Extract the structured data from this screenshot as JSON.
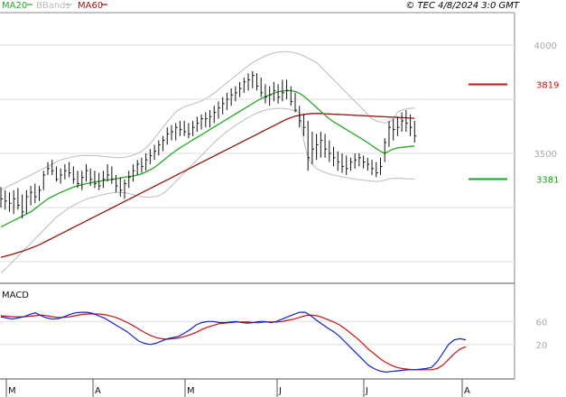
{
  "header": {
    "legend": [
      {
        "label": "MA20",
        "color": "#22aa22"
      },
      {
        "label": "BBands",
        "color": "#bbbbbb"
      },
      {
        "label": "MA60",
        "color": "#991111"
      }
    ],
    "stamp": "© TEC 4/8/2024 3:0 GMT"
  },
  "chart_data": [
    {
      "type": "line",
      "title": "",
      "x_months": [
        "M",
        "A",
        "M",
        "J",
        "J",
        "A"
      ],
      "y_ticks": [
        "4000",
        "3500"
      ],
      "ylim": [
        2900,
        4150
      ],
      "levels": [
        {
          "label": "3819",
          "value": 3819,
          "color": "#cc1111"
        },
        {
          "label": "3381",
          "value": 3381,
          "color": "#11aa11"
        }
      ],
      "n_days": 110,
      "price_ohlc_bars": [
        [
          3345,
          3250,
          3290
        ],
        [
          3330,
          3240,
          3280
        ],
        [
          3320,
          3230,
          3270
        ],
        [
          3330,
          3220,
          3290
        ],
        [
          3340,
          3240,
          3260
        ],
        [
          3310,
          3200,
          3230
        ],
        [
          3330,
          3220,
          3300
        ],
        [
          3350,
          3260,
          3320
        ],
        [
          3360,
          3270,
          3300
        ],
        [
          3350,
          3280,
          3330
        ],
        [
          3420,
          3330,
          3400
        ],
        [
          3460,
          3400,
          3430
        ],
        [
          3470,
          3400,
          3420
        ],
        [
          3440,
          3370,
          3380
        ],
        [
          3430,
          3360,
          3400
        ],
        [
          3450,
          3380,
          3420
        ],
        [
          3460,
          3390,
          3410
        ],
        [
          3440,
          3360,
          3380
        ],
        [
          3420,
          3340,
          3360
        ],
        [
          3420,
          3330,
          3390
        ],
        [
          3450,
          3370,
          3420
        ],
        [
          3430,
          3350,
          3380
        ],
        [
          3420,
          3340,
          3360
        ],
        [
          3410,
          3330,
          3350
        ],
        [
          3420,
          3340,
          3380
        ],
        [
          3450,
          3370,
          3400
        ],
        [
          3440,
          3360,
          3380
        ],
        [
          3400,
          3320,
          3350
        ],
        [
          3390,
          3300,
          3330
        ],
        [
          3380,
          3290,
          3360
        ],
        [
          3420,
          3340,
          3390
        ],
        [
          3450,
          3370,
          3420
        ],
        [
          3470,
          3400,
          3450
        ],
        [
          3480,
          3410,
          3440
        ],
        [
          3500,
          3420,
          3470
        ],
        [
          3520,
          3450,
          3490
        ],
        [
          3540,
          3470,
          3510
        ],
        [
          3560,
          3490,
          3540
        ],
        [
          3580,
          3510,
          3560
        ],
        [
          3620,
          3540,
          3590
        ],
        [
          3630,
          3560,
          3600
        ],
        [
          3640,
          3560,
          3620
        ],
        [
          3650,
          3580,
          3610
        ],
        [
          3650,
          3580,
          3600
        ],
        [
          3640,
          3570,
          3590
        ],
        [
          3650,
          3580,
          3620
        ],
        [
          3670,
          3600,
          3640
        ],
        [
          3680,
          3610,
          3660
        ],
        [
          3690,
          3620,
          3660
        ],
        [
          3700,
          3620,
          3670
        ],
        [
          3720,
          3640,
          3690
        ],
        [
          3740,
          3660,
          3710
        ],
        [
          3760,
          3680,
          3730
        ],
        [
          3780,
          3700,
          3750
        ],
        [
          3800,
          3720,
          3770
        ],
        [
          3810,
          3740,
          3780
        ],
        [
          3830,
          3760,
          3800
        ],
        [
          3850,
          3780,
          3830
        ],
        [
          3870,
          3790,
          3840
        ],
        [
          3880,
          3800,
          3860
        ],
        [
          3870,
          3790,
          3810
        ],
        [
          3850,
          3760,
          3780
        ],
        [
          3820,
          3730,
          3760
        ],
        [
          3810,
          3720,
          3770
        ],
        [
          3830,
          3740,
          3790
        ],
        [
          3820,
          3730,
          3760
        ],
        [
          3840,
          3740,
          3780
        ],
        [
          3840,
          3750,
          3790
        ],
        [
          3810,
          3720,
          3740
        ],
        [
          3780,
          3690,
          3700
        ],
        [
          3720,
          3620,
          3650
        ],
        [
          3680,
          3580,
          3620
        ],
        [
          3650,
          3420,
          3480
        ],
        [
          3600,
          3450,
          3520
        ],
        [
          3590,
          3470,
          3540
        ],
        [
          3600,
          3480,
          3560
        ],
        [
          3590,
          3480,
          3520
        ],
        [
          3560,
          3460,
          3500
        ],
        [
          3530,
          3440,
          3480
        ],
        [
          3510,
          3420,
          3460
        ],
        [
          3500,
          3410,
          3440
        ],
        [
          3490,
          3400,
          3430
        ],
        [
          3480,
          3420,
          3460
        ],
        [
          3500,
          3430,
          3470
        ],
        [
          3500,
          3440,
          3480
        ],
        [
          3490,
          3430,
          3460
        ],
        [
          3480,
          3420,
          3450
        ],
        [
          3470,
          3400,
          3430
        ],
        [
          3460,
          3390,
          3410
        ],
        [
          3480,
          3400,
          3440
        ],
        [
          3570,
          3460,
          3550
        ],
        [
          3650,
          3530,
          3620
        ],
        [
          3660,
          3560,
          3610
        ],
        [
          3670,
          3580,
          3620
        ],
        [
          3690,
          3600,
          3650
        ],
        [
          3700,
          3600,
          3640
        ],
        [
          3680,
          3580,
          3620
        ],
        [
          3650,
          3550,
          3580
        ]
      ],
      "ma20": [
        3160,
        3170,
        3180,
        3190,
        3200,
        3210,
        3220,
        3230,
        3245,
        3260,
        3275,
        3290,
        3300,
        3310,
        3320,
        3328,
        3336,
        3344,
        3350,
        3356,
        3360,
        3364,
        3368,
        3371,
        3374,
        3377,
        3380,
        3383,
        3386,
        3390,
        3393,
        3396,
        3400,
        3406,
        3414,
        3424,
        3436,
        3450,
        3466,
        3482,
        3498,
        3512,
        3526,
        3538,
        3550,
        3562,
        3574,
        3586,
        3598,
        3610,
        3622,
        3634,
        3646,
        3658,
        3670,
        3682,
        3694,
        3706,
        3718,
        3730,
        3742,
        3752,
        3762,
        3770,
        3778,
        3784,
        3788,
        3790,
        3790,
        3786,
        3778,
        3764,
        3748,
        3730,
        3712,
        3694,
        3676,
        3660,
        3646,
        3634,
        3622,
        3610,
        3598,
        3586,
        3574,
        3562,
        3550,
        3536,
        3522,
        3510,
        3500,
        3510,
        3520,
        3525,
        3528,
        3530,
        3532,
        3534
      ],
      "ma60": [
        3020,
        3025,
        3030,
        3036,
        3042,
        3048,
        3055,
        3062,
        3070,
        3078,
        3088,
        3098,
        3108,
        3118,
        3128,
        3138,
        3148,
        3158,
        3168,
        3178,
        3188,
        3198,
        3208,
        3218,
        3228,
        3238,
        3248,
        3258,
        3268,
        3278,
        3288,
        3298,
        3308,
        3318,
        3328,
        3338,
        3348,
        3358,
        3368,
        3378,
        3388,
        3398,
        3408,
        3418,
        3428,
        3438,
        3448,
        3458,
        3468,
        3478,
        3488,
        3498,
        3508,
        3518,
        3528,
        3538,
        3548,
        3558,
        3568,
        3578,
        3588,
        3598,
        3608,
        3618,
        3628,
        3638,
        3648,
        3658,
        3665,
        3672,
        3676,
        3680,
        3682,
        3684,
        3684,
        3684,
        3683,
        3682,
        3681,
        3680,
        3679,
        3678,
        3677,
        3676,
        3675,
        3674,
        3673,
        3672,
        3671,
        3670,
        3669,
        3668,
        3667,
        3666,
        3665,
        3664,
        3663,
        3662
      ],
      "bb_upper": [
        3330,
        3340,
        3350,
        3360,
        3370,
        3380,
        3390,
        3400,
        3410,
        3420,
        3430,
        3440,
        3450,
        3460,
        3470,
        3475,
        3480,
        3485,
        3488,
        3490,
        3490,
        3490,
        3490,
        3488,
        3486,
        3484,
        3482,
        3480,
        3480,
        3482,
        3486,
        3492,
        3500,
        3510,
        3525,
        3545,
        3570,
        3595,
        3620,
        3645,
        3670,
        3690,
        3705,
        3715,
        3722,
        3728,
        3734,
        3742,
        3752,
        3764,
        3778,
        3794,
        3810,
        3826,
        3842,
        3858,
        3874,
        3890,
        3905,
        3918,
        3930,
        3940,
        3950,
        3958,
        3964,
        3968,
        3970,
        3970,
        3968,
        3964,
        3958,
        3950,
        3940,
        3930,
        3920,
        3900,
        3880,
        3860,
        3840,
        3820,
        3800,
        3780,
        3760,
        3740,
        3720,
        3700,
        3680,
        3660,
        3650,
        3645,
        3640,
        3645,
        3660,
        3690,
        3700,
        3705,
        3708,
        3710
      ],
      "bb_lower": [
        2950,
        2965,
        2985,
        3005,
        3025,
        3045,
        3065,
        3085,
        3105,
        3125,
        3145,
        3165,
        3185,
        3205,
        3220,
        3235,
        3248,
        3260,
        3270,
        3280,
        3288,
        3295,
        3300,
        3305,
        3310,
        3314,
        3318,
        3320,
        3320,
        3318,
        3315,
        3310,
        3305,
        3300,
        3298,
        3298,
        3300,
        3305,
        3315,
        3330,
        3350,
        3370,
        3390,
        3410,
        3430,
        3450,
        3470,
        3490,
        3510,
        3530,
        3550,
        3568,
        3585,
        3600,
        3615,
        3630,
        3642,
        3654,
        3666,
        3676,
        3686,
        3694,
        3700,
        3704,
        3706,
        3708,
        3708,
        3706,
        3702,
        3696,
        3690,
        3560,
        3480,
        3450,
        3430,
        3420,
        3412,
        3405,
        3400,
        3396,
        3392,
        3388,
        3384,
        3380,
        3378,
        3376,
        3374,
        3372,
        3370,
        3372,
        3376,
        3382,
        3384,
        3385,
        3384,
        3383,
        3382,
        3381
      ],
      "macd_ticks": [
        "60",
        "20"
      ],
      "macd_ylim": [
        -40,
        120
      ],
      "macd_line": [
        68,
        66,
        64,
        66,
        68,
        72,
        75,
        70,
        66,
        64,
        65,
        68,
        72,
        75,
        76,
        76,
        74,
        70,
        66,
        60,
        54,
        48,
        42,
        34,
        26,
        22,
        20,
        22,
        26,
        30,
        32,
        34,
        40,
        46,
        54,
        58,
        60,
        60,
        58,
        58,
        59,
        60,
        58,
        57,
        58,
        60,
        60,
        58,
        60,
        64,
        68,
        72,
        76,
        76,
        70,
        62,
        55,
        48,
        42,
        34,
        24,
        14,
        4,
        -6,
        -16,
        -22,
        -26,
        -28,
        -27,
        -26,
        -25,
        -24,
        -24,
        -23,
        -22,
        -20,
        -10,
        5,
        20,
        28,
        30,
        28
      ],
      "macd_signal": [
        70,
        69,
        68,
        68,
        68,
        69,
        70,
        71,
        70,
        68,
        67,
        67,
        68,
        70,
        72,
        73,
        73,
        73,
        72,
        70,
        67,
        63,
        58,
        53,
        47,
        41,
        36,
        32,
        30,
        29,
        30,
        31,
        34,
        37,
        41,
        46,
        50,
        53,
        56,
        57,
        58,
        59,
        59,
        59,
        58,
        58,
        59,
        59,
        59,
        60,
        62,
        64,
        67,
        70,
        71,
        70,
        67,
        63,
        59,
        54,
        47,
        39,
        31,
        22,
        12,
        4,
        -4,
        -11,
        -16,
        -20,
        -22,
        -23,
        -24,
        -24,
        -24,
        -24,
        -22,
        -16,
        -6,
        4,
        12,
        16
      ]
    }
  ]
}
